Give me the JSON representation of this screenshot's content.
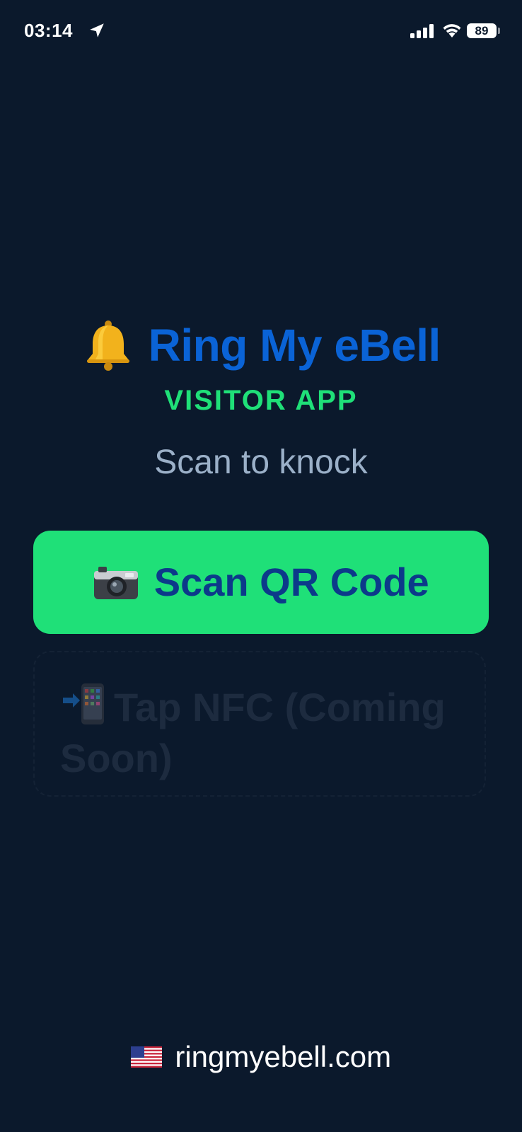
{
  "status_bar": {
    "time": "03:14",
    "battery": "89",
    "icons": [
      "location-arrow-icon",
      "cellular-signal-icon",
      "wifi-icon",
      "battery-icon"
    ]
  },
  "header": {
    "bell_icon": "bell-icon",
    "title": "Ring My eBell",
    "subtitle": "VISITOR APP",
    "tagline": "Scan to knock"
  },
  "actions": {
    "scan": {
      "icon": "camera-icon",
      "label": "Scan QR Code"
    },
    "nfc": {
      "icon": "mobile-nfc-icon",
      "label": "Tap NFC (Coming Soon)",
      "enabled": false
    }
  },
  "footer": {
    "flag_icon": "us-flag-icon",
    "link": "ringmyebell.com"
  },
  "colors": {
    "background": "#0b192c",
    "title": "#0a63d6",
    "accent_green": "#1fe078",
    "button_text": "#0c3a8a",
    "tagline": "#9bb0c8"
  }
}
